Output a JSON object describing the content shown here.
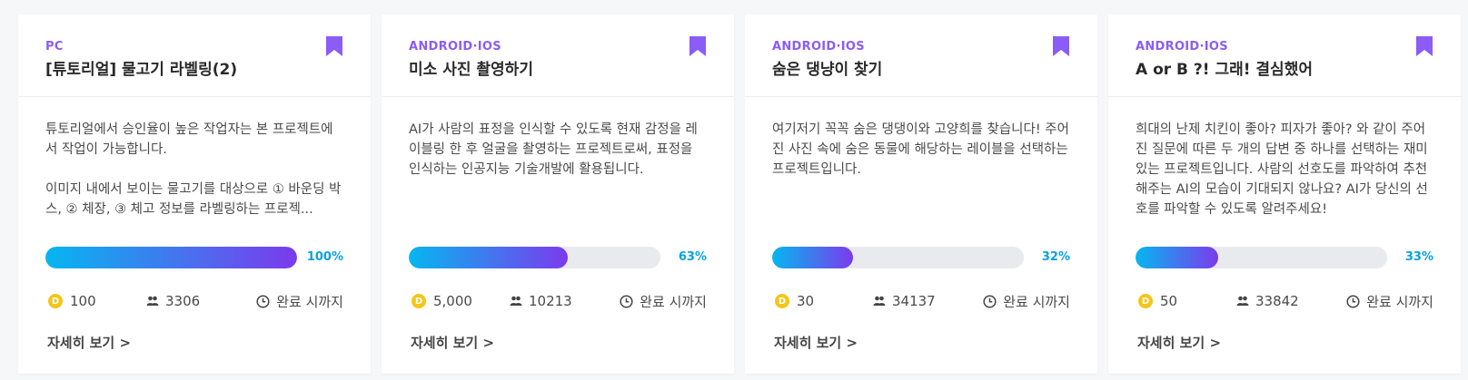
{
  "colors": {
    "platform": "#8b5cf6",
    "bookmark": "#8b5cf6",
    "progress_start": "#06b6f0",
    "progress_end": "#7c3aed",
    "percent": "#06a3e0",
    "coin": "#f5c518"
  },
  "icons": {
    "bookmark": "bookmark-icon",
    "coin": "coin-icon",
    "people": "people-icon",
    "clock": "clock-icon"
  },
  "coin_symbol": "D",
  "cards": [
    {
      "platform": "PC",
      "title": "[튜토리얼] 물고기 라벨링(2)",
      "description": "튜토리얼에서 승인율이 높은 작업자는 본 프로젝트에 서 작업이 가능합니다.\n\n이미지 내에서 보이는 물고기를 대상으로 ① 바운딩 박스, ② 체장, ③ 체고 정보를 라벨링하는 프로젝...",
      "progress": 100,
      "progress_label": "100%",
      "points": "100",
      "participants": "3306",
      "deadline": "완료 시까지",
      "more": "자세히 보기 >"
    },
    {
      "platform": "ANDROID·IOS",
      "title": "미소 사진 촬영하기",
      "description": "AI가 사람의 표정을 인식할 수 있도록 현재 감정을 레이블링 한 후 얼굴을 촬영하는 프로젝트로써, 표정을 인식하는 인공지능 기술개발에 활용됩니다.",
      "progress": 63,
      "progress_label": "63%",
      "points": "5,000",
      "participants": "10213",
      "deadline": "완료 시까지",
      "more": "자세히 보기 >"
    },
    {
      "platform": "ANDROID·IOS",
      "title": "숨은 댕냥이 찾기",
      "description": "여기저기 꼭꼭 숨은 댕댕이와 고양희를 찾습니다! 주어진 사진 속에 숨은 동물에 해당하는 레이블을 선택하는 프로젝트입니다.",
      "progress": 32,
      "progress_label": "32%",
      "points": "30",
      "participants": "34137",
      "deadline": "완료 시까지",
      "more": "자세히 보기 >"
    },
    {
      "platform": "ANDROID·IOS",
      "title": "A or B ?! 그래! 결심했어",
      "description": "희대의 난제 치킨이 좋아? 피자가 좋아? 와 같이 주어진 질문에 따른 두 개의 답변 중 하나를 선택하는 재미있는 프로젝트입니다. 사람의 선호도를 파악하여 추천해주는 AI의 모습이 기대되지 않나요? AI가 당신의 선호를 파악할 수 있도록 알려주세요!",
      "progress": 33,
      "progress_label": "33%",
      "points": "50",
      "participants": "33842",
      "deadline": "완료 시까지",
      "more": "자세히 보기 >"
    }
  ]
}
